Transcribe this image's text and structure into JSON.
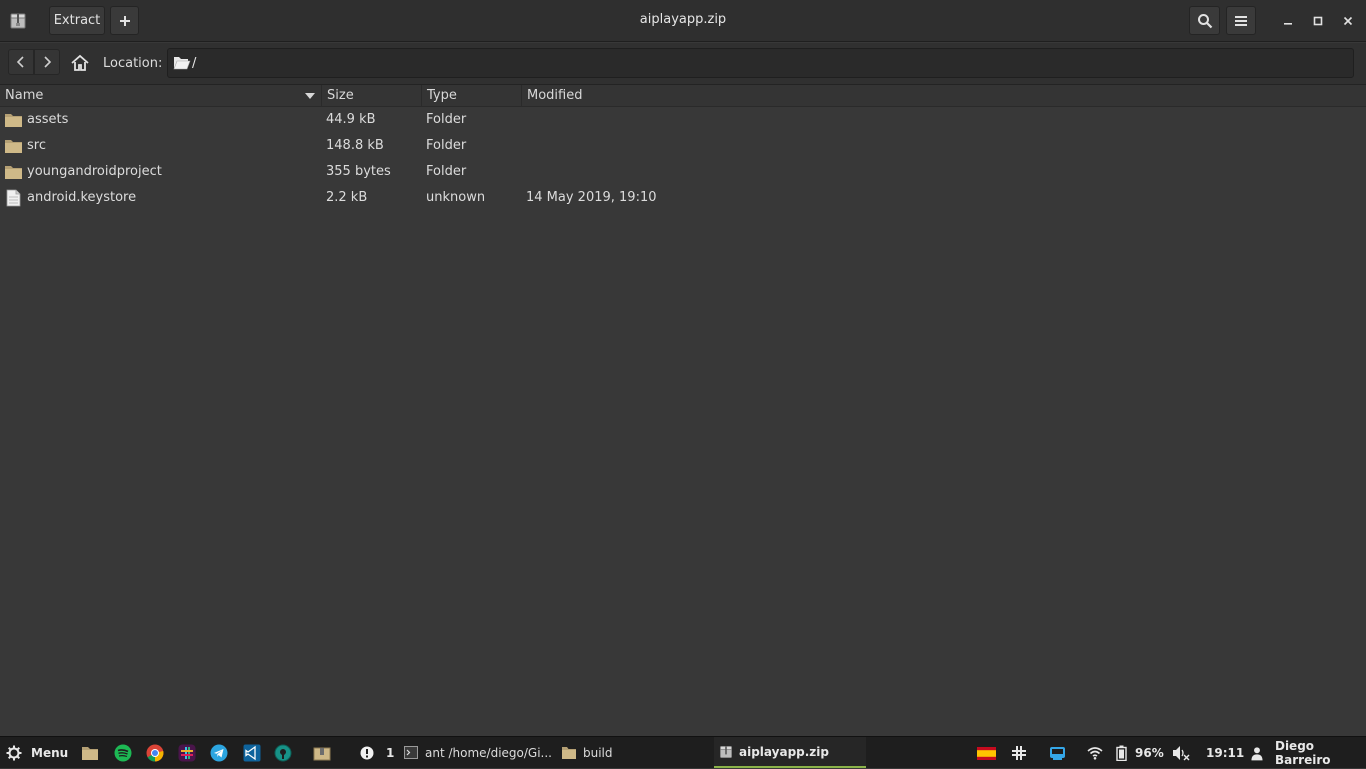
{
  "header": {
    "title": "aiplayapp.zip",
    "extract_label": "Extract",
    "add_label": "+"
  },
  "location": {
    "label": "Location:",
    "path": "/"
  },
  "columns": {
    "name": "Name",
    "size": "Size",
    "type": "Type",
    "modified": "Modified"
  },
  "files": [
    {
      "name": "assets",
      "size": "44.9 kB",
      "type": "Folder",
      "modified": "",
      "icon": "folder-icon"
    },
    {
      "name": "src",
      "size": "148.8 kB",
      "type": "Folder",
      "modified": "",
      "icon": "folder-icon"
    },
    {
      "name": "youngandroidproject",
      "size": "355 bytes",
      "type": "Folder",
      "modified": "",
      "icon": "folder-icon"
    },
    {
      "name": "android.keystore",
      "size": "2.2 kB",
      "type": "unknown",
      "modified": "14 May 2019, 19:10",
      "icon": "file-icon"
    }
  ],
  "taskbar": {
    "menu_label": "Menu",
    "notification_count": "1",
    "tasks": [
      {
        "label": "ant  /home/diego/Gi..."
      },
      {
        "label": "build"
      },
      {
        "label": "aiplayapp.zip"
      }
    ],
    "battery": "96%",
    "clock": "19:11",
    "user": "Diego Barreiro"
  },
  "colors": {
    "accent": "#8bb34a",
    "folder": "#cfb988",
    "background": "#383838"
  }
}
